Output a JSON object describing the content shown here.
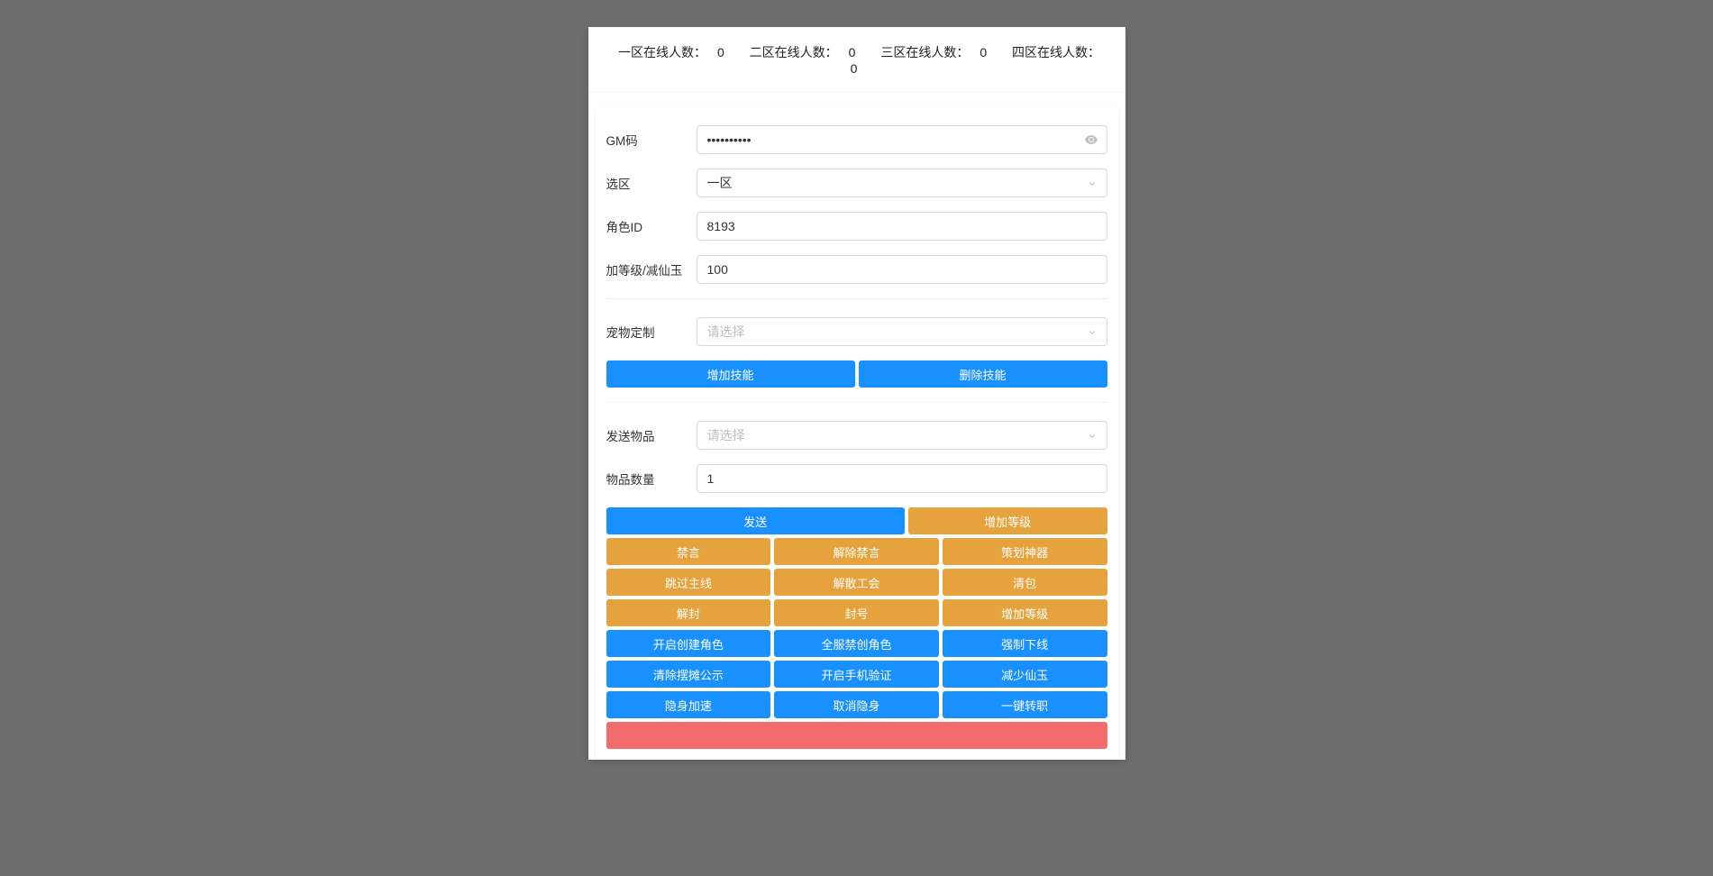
{
  "stats": {
    "zone1_label": "一区在线人数：",
    "zone1_value": "0",
    "zone2_label": "二区在线人数：",
    "zone2_value": "0",
    "zone3_label": "三区在线人数：",
    "zone3_value": "0",
    "zone4_label": "四区在线人数：",
    "zone4_value": "0"
  },
  "form": {
    "gm_label": "GM码",
    "gm_value": "••••••••••",
    "zone_label": "选区",
    "zone_value": "一区",
    "role_label": "角色ID",
    "role_value": "8193",
    "level_label": "加等级/减仙玉",
    "level_value": "100",
    "pet_label": "宠物定制",
    "pet_placeholder": "请选择",
    "item_label": "发送物品",
    "item_placeholder": "请选择",
    "qty_label": "物品数量",
    "qty_value": "1"
  },
  "buttons": {
    "add_skill": "增加技能",
    "del_skill": "删除技能",
    "send": "发送",
    "add_level": "增加等级",
    "mute": "禁言",
    "unmute": "解除禁言",
    "plan_artifact": "策划神器",
    "skip_main": "跳过主线",
    "disband_guild": "解散工会",
    "clear_bag": "清包",
    "unseal": "解封",
    "seal": "封号",
    "add_level2": "增加等级",
    "open_create": "开启创建角色",
    "global_nocreate": "全服禁创角色",
    "force_offline": "强制下线",
    "clear_display": "清除摆摊公示",
    "open_phone": "开启手机验证",
    "reduce_xianyu": "减少仙玉",
    "stealth_speed": "隐身加速",
    "cancel_stealth": "取消隐身",
    "one_click_job": "一键转职"
  }
}
